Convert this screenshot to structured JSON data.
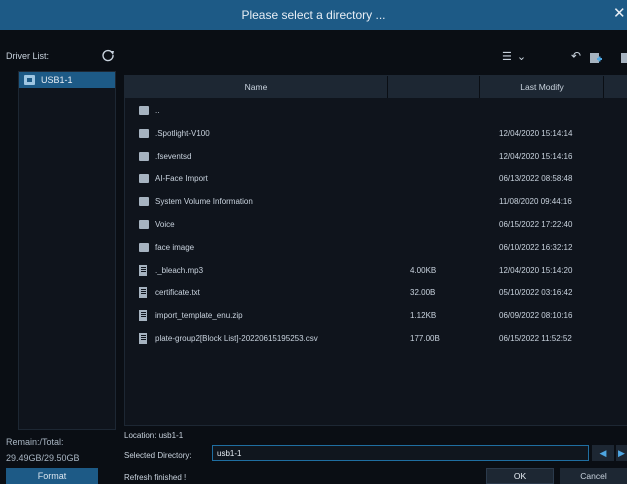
{
  "dialog": {
    "title": "Please select a directory ...",
    "close_glyph": "✕"
  },
  "sidebar": {
    "driver_list_label": "Driver List:",
    "drives": [
      {
        "label": "USB1-1",
        "icon": "usb-drive-icon"
      }
    ],
    "remain_label": "Remain:/Total:",
    "remain_value": "29.49GB/29.50GB",
    "format_label": "Format"
  },
  "toolbar": {
    "view_glyph": "☰",
    "dropdown_glyph": "⌄",
    "back_glyph": "↶"
  },
  "table": {
    "columns": [
      "Name",
      "",
      "Last Modify",
      ""
    ],
    "rows": [
      {
        "type": "folder",
        "name": "..",
        "size": "",
        "modified": ""
      },
      {
        "type": "folder",
        "name": ".Spotlight-V100",
        "size": "",
        "modified": "12/04/2020 15:14:14"
      },
      {
        "type": "folder",
        "name": ".fseventsd",
        "size": "",
        "modified": "12/04/2020 15:14:16"
      },
      {
        "type": "folder",
        "name": "AI-Face Import",
        "size": "",
        "modified": "06/13/2022 08:58:48"
      },
      {
        "type": "folder",
        "name": "System Volume Information",
        "size": "",
        "modified": "11/08/2020 09:44:16"
      },
      {
        "type": "folder",
        "name": "Voice",
        "size": "",
        "modified": "06/15/2022 17:22:40"
      },
      {
        "type": "folder",
        "name": "face image",
        "size": "",
        "modified": "06/10/2022 16:32:12"
      },
      {
        "type": "file",
        "name": "._bleach.mp3",
        "size": "4.00KB",
        "modified": "12/04/2020 15:14:20"
      },
      {
        "type": "file",
        "name": "certificate.txt",
        "size": "32.00B",
        "modified": "05/10/2022 03:16:42"
      },
      {
        "type": "file",
        "name": "import_template_enu.zip",
        "size": "1.12KB",
        "modified": "06/09/2022 08:10:16"
      },
      {
        "type": "file",
        "name": "plate-group2[Block List]-20220615195253.csv",
        "size": "177.00B",
        "modified": "06/15/2022 11:52:52"
      }
    ]
  },
  "footer": {
    "location": "Location: usb1-1",
    "selected_directory_label": "Selected Directory:",
    "selected_directory_value": "usb1-1",
    "nav_left_glyph": "◀",
    "nav_right_glyph": "▶",
    "status": "Refresh finished !",
    "ok_label": "OK",
    "cancel_label": "Cancel"
  },
  "colors": {
    "title_bar": "#1d5a86",
    "background": "#0a0e14",
    "panel": "#0f141c",
    "header": "#1d2733",
    "accent": "#4ea6e2"
  }
}
